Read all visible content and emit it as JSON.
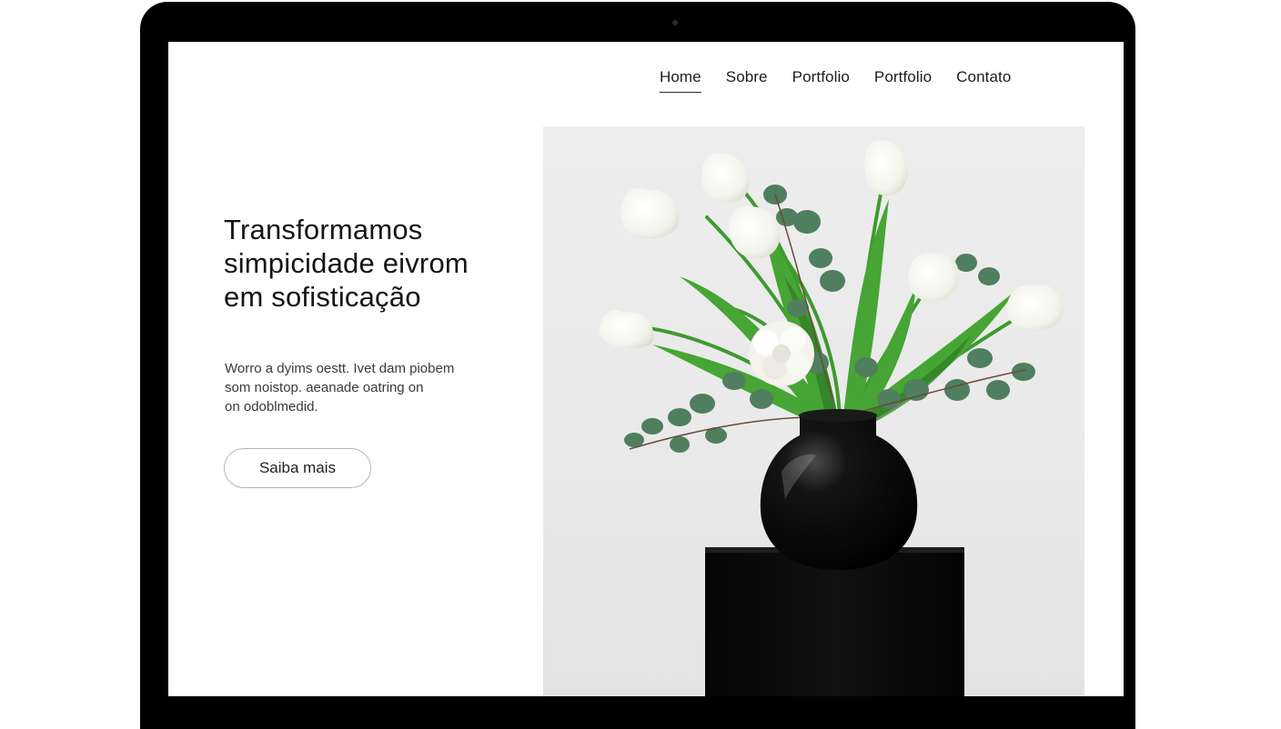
{
  "nav": {
    "items": [
      {
        "label": "Home",
        "active": true
      },
      {
        "label": "Sobre",
        "active": false
      },
      {
        "label": "Portfolio",
        "active": false
      },
      {
        "label": "Portfolio",
        "active": false
      },
      {
        "label": "Contato",
        "active": false
      }
    ]
  },
  "hero": {
    "title_lines": [
      "Transformamos",
      "simpicidade eivrom",
      "em sofisticação"
    ],
    "description_lines": [
      "Worro a dyims oestt. Ivet dam piobem",
      "som noistop. aeanade oatring on",
      "on odoblmedid."
    ],
    "cta_label": "Saiba mais",
    "image": {
      "subject": "white tulips and eucalyptus in black round vase on black pedestal"
    }
  },
  "colors": {
    "bezel": "#000000",
    "screen_bg": "#ffffff",
    "text": "#151515",
    "button_border": "#b5b5b5",
    "photo_bg": "#ececec",
    "leaf_green": "#3f9a2f",
    "eucalyptus": "#4f7f5e"
  }
}
